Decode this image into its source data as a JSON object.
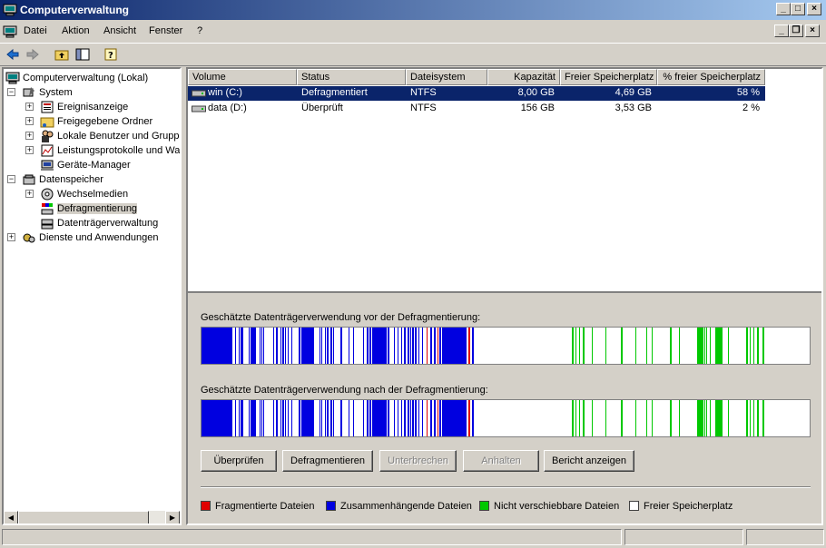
{
  "window": {
    "title": "Computerverwaltung"
  },
  "menu": [
    "Datei",
    "Aktion",
    "Ansicht",
    "Fenster",
    "?"
  ],
  "tree": [
    {
      "label": "Computerverwaltung (Lokal)"
    },
    {
      "label": "System"
    },
    {
      "label": "Ereignisanzeige"
    },
    {
      "label": "Freigegebene Ordner"
    },
    {
      "label": "Lokale Benutzer und Gruppen"
    },
    {
      "label": "Leistungsprotokolle und Warnungen"
    },
    {
      "label": "Geräte-Manager"
    },
    {
      "label": "Datenspeicher"
    },
    {
      "label": "Wechselmedien"
    },
    {
      "label": "Defragmentierung"
    },
    {
      "label": "Datenträgerverwaltung"
    },
    {
      "label": "Dienste und Anwendungen"
    }
  ],
  "volumes": {
    "columns": [
      "Volume",
      "Status",
      "Dateisystem",
      "Kapazität",
      "Freier Speicherplatz",
      "% freier Speicherplatz"
    ],
    "rows": [
      {
        "volume": "win (C:)",
        "status": "Defragmentiert",
        "fs": "NTFS",
        "capacity": "8,00 GB",
        "free": "4,69 GB",
        "pct": "58 %"
      },
      {
        "volume": "data (D:)",
        "status": "Überprüft",
        "fs": "NTFS",
        "capacity": "156 GB",
        "free": "3,53 GB",
        "pct": "2 %"
      }
    ]
  },
  "analysis": {
    "before_label": "Geschätzte Datenträgerverwendung vor der Defragmentierung:",
    "after_label": "Geschätzte Datenträgerverwendung nach der Defragmentierung:"
  },
  "buttons": {
    "analyze": "Überprüfen",
    "defrag": "Defragmentieren",
    "pause": "Unterbrechen",
    "stop": "Anhalten",
    "report": "Bericht anzeigen"
  },
  "legend": [
    {
      "label": "Fragmentierte Dateien",
      "color": "#e00000"
    },
    {
      "label": "Zusammenhängende Dateien",
      "color": "#0000e0"
    },
    {
      "label": "Nicht verschiebbare Dateien",
      "color": "#00c800"
    },
    {
      "label": "Freier Speicherplatz",
      "color": "#ffffff"
    }
  ],
  "colors": {
    "selection": "#0a246a",
    "title_start": "#0a246a",
    "title_end": "#a6caf0"
  }
}
